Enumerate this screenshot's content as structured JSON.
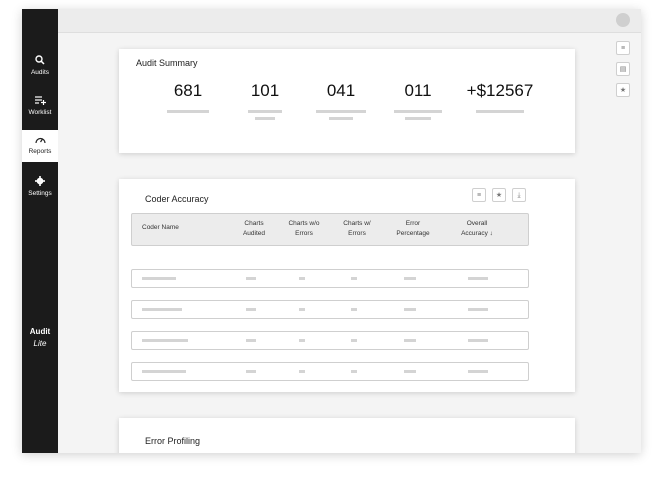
{
  "sidebar": {
    "items": [
      {
        "label": "Audits",
        "icon": "search-icon"
      },
      {
        "label": "Worklist",
        "icon": "playlist-add-icon"
      },
      {
        "label": "Reports",
        "icon": "speedometer-icon"
      },
      {
        "label": "Settings",
        "icon": "gear-icon"
      }
    ],
    "brand_line1": "Audit",
    "brand_line2": "Lite"
  },
  "audit_summary": {
    "title": "Audit Summary",
    "stats": [
      {
        "value": "681"
      },
      {
        "value": "101"
      },
      {
        "value": "041"
      },
      {
        "value": "011"
      },
      {
        "value": "+$12567"
      }
    ]
  },
  "coder_accuracy": {
    "title": "Coder Accuracy",
    "columns": [
      {
        "line1": "Coder Name",
        "line2": ""
      },
      {
        "line1": "Charts",
        "line2": "Audited"
      },
      {
        "line1": "Charts w/o",
        "line2": "Errors"
      },
      {
        "line1": "Charts w/",
        "line2": "Errors"
      },
      {
        "line1": "Error",
        "line2": "Percentage"
      },
      {
        "line1": "Overall",
        "line2": "Accuracy ↓"
      }
    ],
    "rows": 4
  },
  "error_profiling": {
    "title": "Error Profiling"
  },
  "colors": {
    "sidebar": "#1b1b1b",
    "background": "#f4f4f4",
    "placeholder": "#d4d4d4"
  }
}
